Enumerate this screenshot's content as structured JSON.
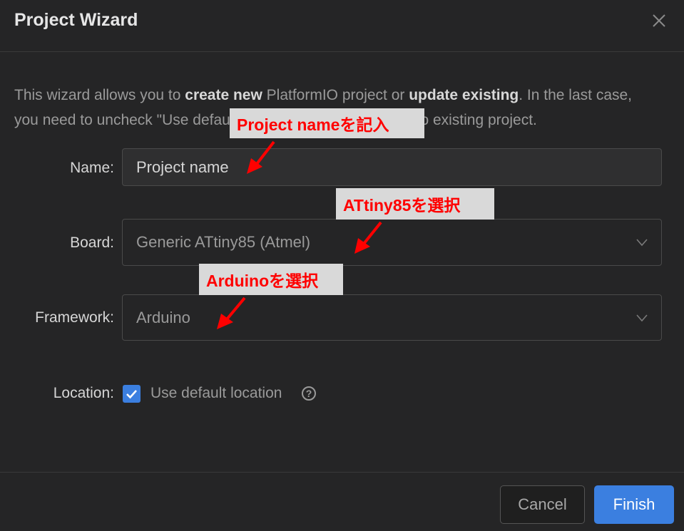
{
  "dialog": {
    "title": "Project Wizard",
    "close_icon": "close-icon",
    "description": {
      "part1": "This wizard allows you to ",
      "bold1": "create new",
      "part2": " PlatformIO project or ",
      "bold2": "update existing",
      "part3": ". In the last case, you need to uncheck \"Use default location\" and specify path to existing project."
    }
  },
  "form": {
    "name_label": "Name",
    "name_value": "Project name",
    "board_label": "Board",
    "board_value": "Generic ATtiny85 (Atmel)",
    "framework_label": "Framework",
    "framework_value": "Arduino",
    "location_label": "Location",
    "use_default_location_label": "Use default location",
    "use_default_location_checked": true,
    "help_icon": "question-circle-icon",
    "colon": ":"
  },
  "footer": {
    "cancel_label": "Cancel",
    "finish_label": "Finish"
  },
  "annotations": {
    "name_callout": "Project nameを記入",
    "board_callout": "ATtiny85を選択",
    "framework_callout": "Arduinoを選択",
    "color": "#ff0000"
  },
  "colors": {
    "background": "#252526",
    "accent": "#3b7fe0"
  }
}
